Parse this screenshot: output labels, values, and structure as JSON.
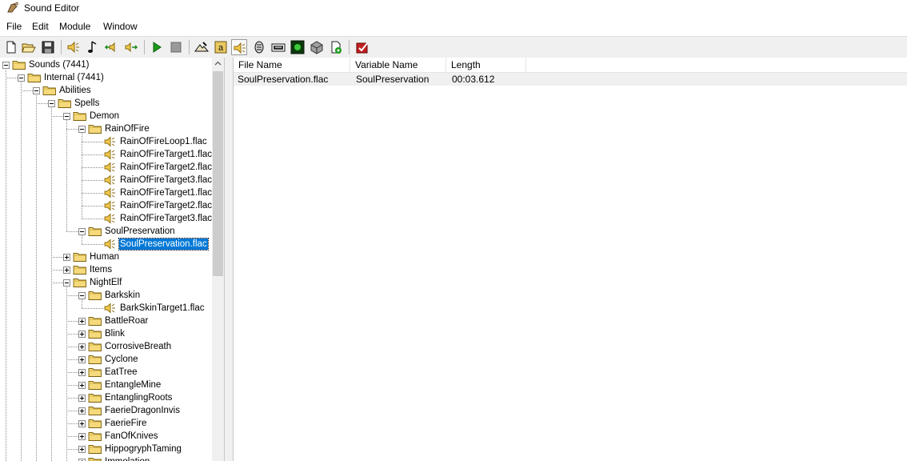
{
  "window": {
    "title": "Sound Editor"
  },
  "menu": [
    "File",
    "Edit",
    "Module",
    "Window"
  ],
  "colors": {
    "selection": "#0078d7",
    "folder": "#f5d97a",
    "speaker": "#f2c94c"
  },
  "toolbar": {
    "buttons": [
      {
        "name": "new-icon"
      },
      {
        "name": "open-icon"
      },
      {
        "name": "save-icon"
      },
      {
        "name": "speaker-icon"
      },
      {
        "name": "music-note-icon"
      },
      {
        "name": "import-sound-icon"
      },
      {
        "name": "export-sound-icon"
      },
      {
        "name": "play-icon"
      },
      {
        "name": "stop-icon"
      },
      {
        "name": "terrain-editor-icon"
      },
      {
        "name": "trigger-editor-icon"
      },
      {
        "name": "sound-editor-icon",
        "pressed": true
      },
      {
        "name": "object-editor-icon"
      },
      {
        "name": "campaign-editor-icon"
      },
      {
        "name": "ai-editor-icon"
      },
      {
        "name": "object-manager-icon"
      },
      {
        "name": "import-manager-icon"
      },
      {
        "name": "test-map-icon"
      }
    ]
  },
  "tree": [
    {
      "label": "Sounds (7441)",
      "level": 0,
      "type": "folder",
      "expander": "minus"
    },
    {
      "label": "Internal (7441)",
      "level": 1,
      "type": "folder",
      "expander": "minus"
    },
    {
      "label": "Abilities",
      "level": 2,
      "type": "folder",
      "expander": "minus"
    },
    {
      "label": "Spells",
      "level": 3,
      "type": "folder",
      "expander": "minus"
    },
    {
      "label": "Demon",
      "level": 4,
      "type": "folder",
      "expander": "minus"
    },
    {
      "label": "RainOfFire",
      "level": 5,
      "type": "folder",
      "expander": "minus"
    },
    {
      "label": "RainOfFireLoop1.flac",
      "level": 6,
      "type": "sound"
    },
    {
      "label": "RainOfFireTarget1.flac",
      "level": 6,
      "type": "sound"
    },
    {
      "label": "RainOfFireTarget2.flac",
      "level": 6,
      "type": "sound"
    },
    {
      "label": "RainOfFireTarget3.flac",
      "level": 6,
      "type": "sound"
    },
    {
      "label": "RainOfFireTarget1.flac",
      "level": 6,
      "type": "sound"
    },
    {
      "label": "RainOfFireTarget2.flac",
      "level": 6,
      "type": "sound"
    },
    {
      "label": "RainOfFireTarget3.flac",
      "level": 6,
      "type": "sound"
    },
    {
      "label": "SoulPreservation",
      "level": 5,
      "type": "folder",
      "expander": "minus"
    },
    {
      "label": "SoulPreservation.flac",
      "level": 6,
      "type": "sound",
      "selected": true
    },
    {
      "label": "Human",
      "level": 4,
      "type": "folder",
      "expander": "plus"
    },
    {
      "label": "Items",
      "level": 4,
      "type": "folder",
      "expander": "plus"
    },
    {
      "label": "NightElf",
      "level": 4,
      "type": "folder",
      "expander": "minus"
    },
    {
      "label": "Barkskin",
      "level": 5,
      "type": "folder",
      "expander": "minus"
    },
    {
      "label": "BarkSkinTarget1.flac",
      "level": 6,
      "type": "sound"
    },
    {
      "label": "BattleRoar",
      "level": 5,
      "type": "folder",
      "expander": "plus"
    },
    {
      "label": "Blink",
      "level": 5,
      "type": "folder",
      "expander": "plus"
    },
    {
      "label": "CorrosiveBreath",
      "level": 5,
      "type": "folder",
      "expander": "plus"
    },
    {
      "label": "Cyclone",
      "level": 5,
      "type": "folder",
      "expander": "plus"
    },
    {
      "label": "EatTree",
      "level": 5,
      "type": "folder",
      "expander": "plus"
    },
    {
      "label": "EntangleMine",
      "level": 5,
      "type": "folder",
      "expander": "plus"
    },
    {
      "label": "EntanglingRoots",
      "level": 5,
      "type": "folder",
      "expander": "plus"
    },
    {
      "label": "FaerieDragonInvis",
      "level": 5,
      "type": "folder",
      "expander": "plus"
    },
    {
      "label": "FaerieFire",
      "level": 5,
      "type": "folder",
      "expander": "plus"
    },
    {
      "label": "FanOfKnives",
      "level": 5,
      "type": "folder",
      "expander": "plus"
    },
    {
      "label": "HippogryphTaming",
      "level": 5,
      "type": "folder",
      "expander": "plus"
    },
    {
      "label": "Immolation",
      "level": 5,
      "type": "folder",
      "expander": "plus"
    }
  ],
  "list": {
    "columns": [
      "File Name",
      "Variable Name",
      "Length"
    ],
    "rows": [
      [
        "SoulPreservation.flac",
        "SoulPreservation",
        "00:03.612"
      ]
    ]
  }
}
